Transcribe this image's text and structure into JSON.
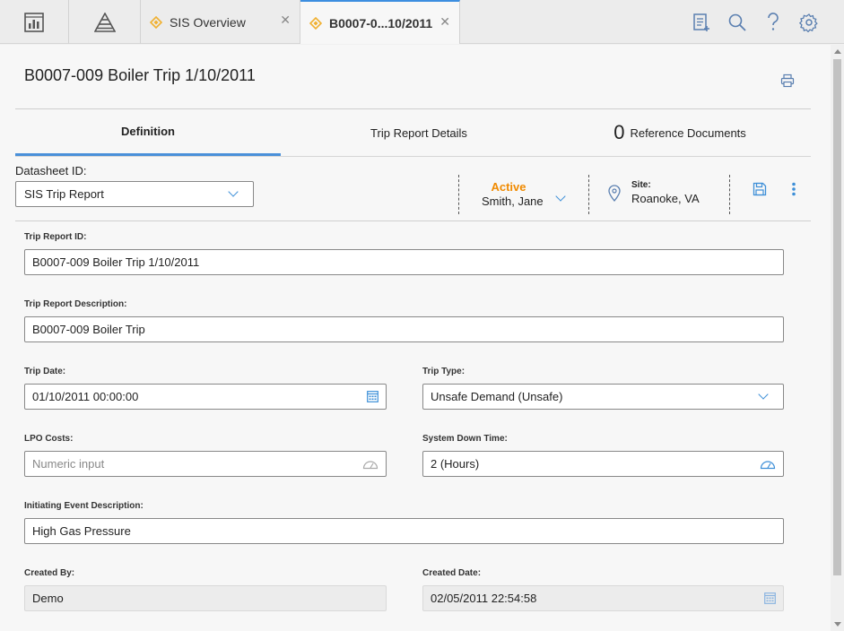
{
  "topbar": {
    "tabs": [
      {
        "label": "SIS Overview"
      },
      {
        "label": "B0007-0...10/2011"
      }
    ],
    "close_glyph": "✕",
    "icons": [
      "dashboard-icon",
      "hierarchy-icon",
      "add-report-icon",
      "search-icon",
      "help-icon",
      "settings-icon"
    ]
  },
  "page": {
    "title": "B0007-009 Boiler Trip 1/10/2011"
  },
  "subtabs": [
    {
      "label": "Definition"
    },
    {
      "label": "Trip Report Details"
    },
    {
      "count": "0",
      "label": "Reference Documents"
    }
  ],
  "toolbar": {
    "datasheet_label": "Datasheet ID:",
    "datasheet_value": "SIS Trip Report",
    "state": "Active",
    "owner": "Smith, Jane",
    "site_label": "Site:",
    "site_value": "Roanoke, VA"
  },
  "form": {
    "trip_report_id": {
      "label": "Trip Report ID:",
      "value": "B0007-009 Boiler Trip 1/10/2011"
    },
    "description": {
      "label": "Trip Report Description:",
      "value": "B0007-009 Boiler Trip"
    },
    "trip_date": {
      "label": "Trip Date:",
      "value": "01/10/2011 00:00:00"
    },
    "trip_type": {
      "label": "Trip Type:",
      "value": "Unsafe Demand (Unsafe)"
    },
    "lpo_costs": {
      "label": "LPO Costs:",
      "placeholder": "Numeric input"
    },
    "system_down_time": {
      "label": "System Down Time:",
      "value": "2 (Hours)"
    },
    "initiating_event": {
      "label": "Initiating Event Description:",
      "value": "High Gas Pressure"
    },
    "created_by": {
      "label": "Created By:",
      "value": "Demo"
    },
    "created_date": {
      "label": "Created Date:",
      "value": "02/05/2011 22:54:58"
    }
  },
  "colors": {
    "accent": "#3d8fd8",
    "state": "#f08a00",
    "tab_diamond": "#f0b030"
  }
}
